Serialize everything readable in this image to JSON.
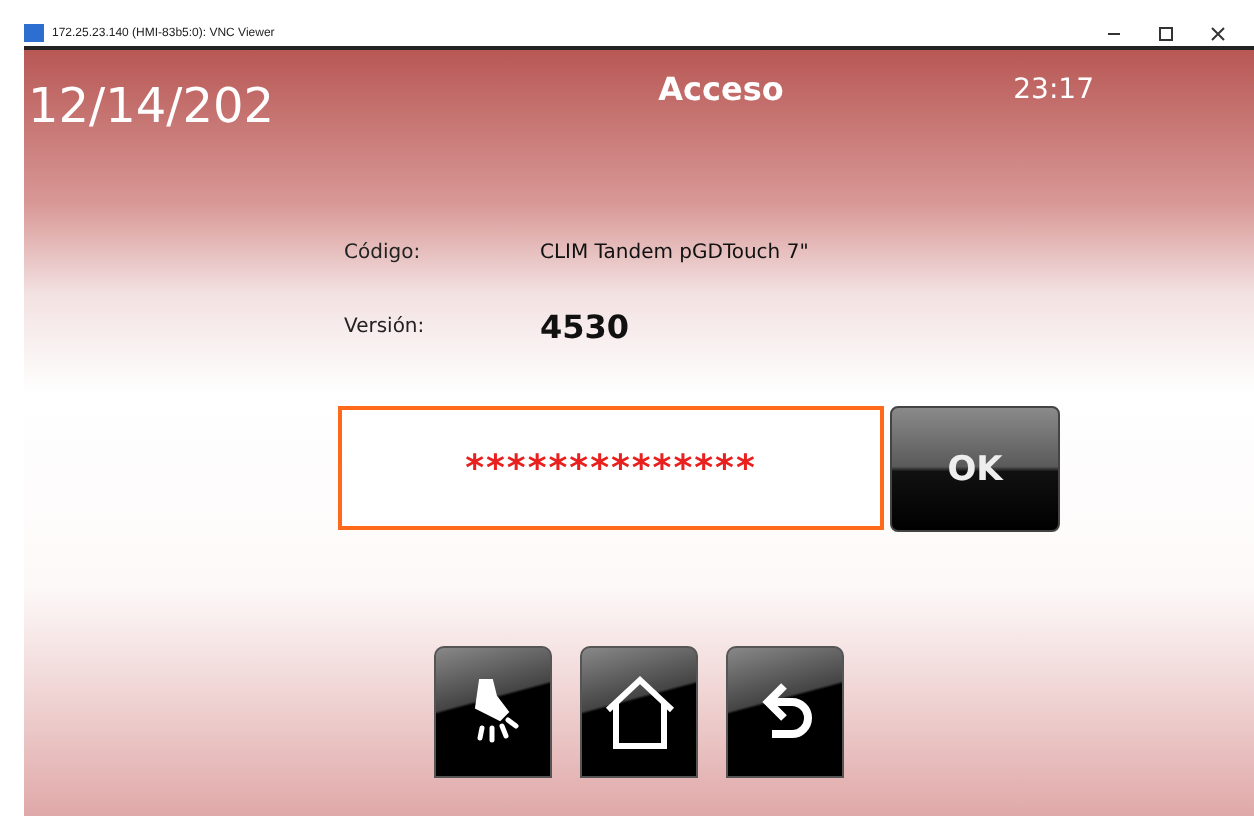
{
  "window": {
    "title": "172.25.23.140 (HMI-83b5:0): VNC Viewer"
  },
  "header": {
    "date": "12/14/202",
    "title": "Acceso",
    "time": "23:17"
  },
  "info": [
    {
      "label": "Código:",
      "value": "CLIM Tandem pGDTouch 7\"",
      "kind": "plain"
    },
    {
      "label": "Versión:",
      "value": "4530",
      "kind": "bold"
    }
  ],
  "password": {
    "value": "**************"
  },
  "ok_button": "OK",
  "nav_buttons": [
    {
      "kind": "alarm"
    },
    {
      "kind": "home"
    },
    {
      "kind": "back"
    }
  ]
}
